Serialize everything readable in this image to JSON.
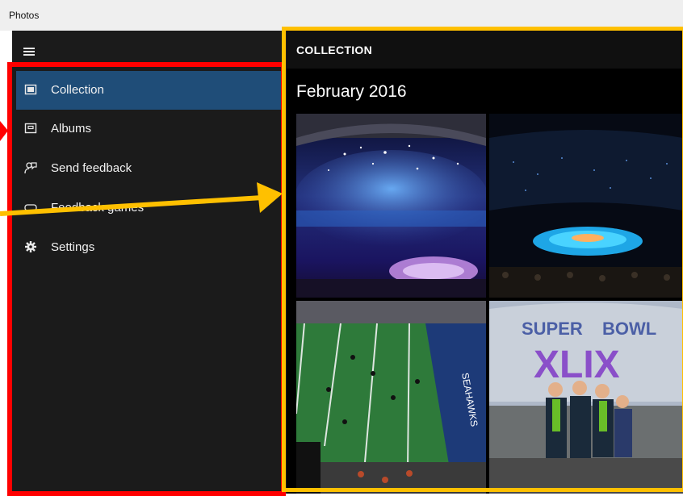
{
  "window": {
    "title": "Photos"
  },
  "nav": {
    "menu_icon": "hamburger-icon",
    "items": [
      {
        "label": "Collection",
        "icon": "photo-collection-icon",
        "active": true
      },
      {
        "label": "Albums",
        "icon": "album-icon",
        "active": false
      },
      {
        "label": "Send feedback",
        "icon": "feedback-icon",
        "active": false
      },
      {
        "label": "Feedback games",
        "icon": "games-icon",
        "active": false
      },
      {
        "label": "Settings",
        "icon": "gear-icon",
        "active": false
      }
    ]
  },
  "content": {
    "header": "COLLECTION",
    "month": "February 2016",
    "photos": [
      {
        "subject": "stadium halftime show with fireworks"
      },
      {
        "subject": "stadium halftime stage lit at night"
      },
      {
        "subject": "football field with Seahawks end zone"
      },
      {
        "subject": "fans in front of Super Bowl XLIX sign"
      }
    ]
  },
  "annotations": {
    "red_box_color": "#ff0000",
    "yellow_box_color": "#ffc000",
    "nav_active_color": "#1f4d78"
  }
}
